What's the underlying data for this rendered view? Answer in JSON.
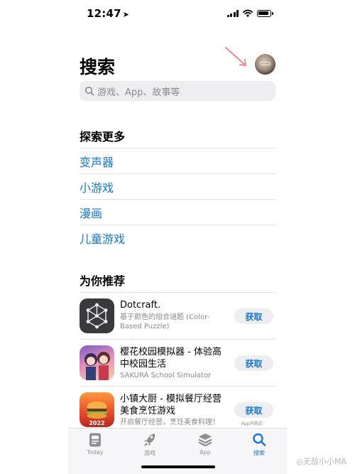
{
  "status_bar": {
    "time": "12:47",
    "location_arrow": "➤"
  },
  "header": {
    "title": "搜索"
  },
  "search": {
    "placeholder": "游戏、App、故事等"
  },
  "explore": {
    "title": "探索更多",
    "items": [
      {
        "label": "变声器"
      },
      {
        "label": "小游戏"
      },
      {
        "label": "漫画"
      },
      {
        "label": "儿童游戏"
      }
    ]
  },
  "recommend": {
    "title": "为你推荐",
    "apps": [
      {
        "name": "Dotcraft.",
        "subtitle": "基于颜色的组合谜题 (Color-Based Puzzle)",
        "button": "获取",
        "icon": "dotcraft-icon"
      },
      {
        "name": "樱花校园模拟器 - 体验高中校园生活",
        "subtitle": "SAKURA School Simulator",
        "button": "获取",
        "icon": "sakura-icon"
      },
      {
        "name": "小镇大厨 - 模拟餐厅经营美食烹饪游戏",
        "subtitle": "开启餐厅经营，烹饪美食料理！",
        "button": "获取",
        "iap_note": "App内购买",
        "icon": "chef-icon"
      }
    ]
  },
  "tabbar": {
    "tabs": [
      {
        "label": "Today",
        "icon": "today-icon"
      },
      {
        "label": "游戏",
        "icon": "rocket-icon"
      },
      {
        "label": "App",
        "icon": "app-stack-icon"
      },
      {
        "label": "搜索",
        "icon": "search-icon",
        "active": true
      }
    ]
  },
  "watermark": "无敌小小MA",
  "colors": {
    "accent": "#1677d9",
    "background": "#ffffff",
    "separator": "#e2e2e4"
  }
}
